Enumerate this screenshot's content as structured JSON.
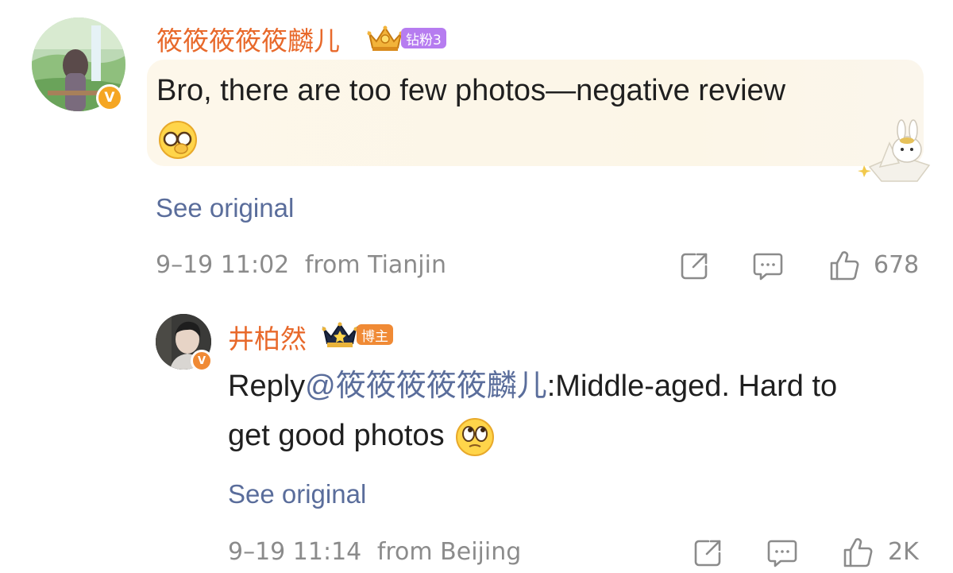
{
  "comment": {
    "username": "筱筱筱筱筱麟儿",
    "fan_badge": "钻粉3",
    "text": "Bro, there are too few photos—negative review",
    "see_original": "See original",
    "timestamp": "9–19 11:02",
    "location": "from Tianjin",
    "like_count": "678"
  },
  "reply": {
    "username": "井柏然",
    "host_badge": "博主",
    "prefix": "Reply",
    "mention": "@筱筱筱筱筱麟儿",
    "text_line1": ":Middle-aged. Hard to",
    "text_line2": "get good photos",
    "see_original": "See original",
    "timestamp": "9–19 11:14",
    "location": "from Beijing",
    "like_count": "2K"
  },
  "colors": {
    "username": "#e8692b",
    "link": "#5a6d9b",
    "meta": "#8b8b8b",
    "fan_badge": "#b67cf0",
    "host_badge": "#f08a35",
    "verified": "#f5a623"
  },
  "icons": {
    "verified": "v-verified-badge",
    "crown": "crown-icon",
    "share": "share-icon",
    "comment": "comment-icon",
    "like": "thumbs-up-icon"
  }
}
